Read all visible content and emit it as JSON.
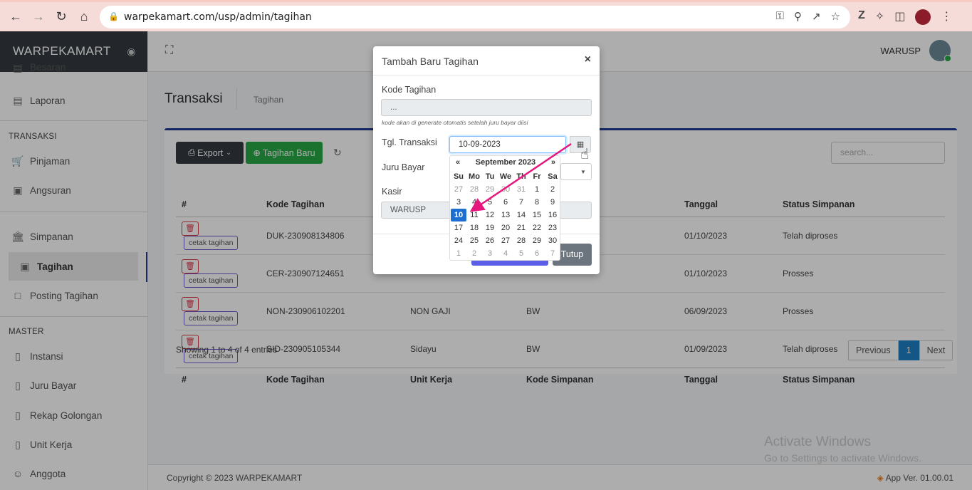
{
  "browser": {
    "url": "warpekamart.com/usp/admin/tagihan"
  },
  "sidebar": {
    "brand": "WARPEKAMART",
    "items_top": [
      {
        "label": "Besaran",
        "icon": "book-icon"
      },
      {
        "label": "Laporan",
        "icon": "clipboard-icon"
      }
    ],
    "section_transaksi": "TRANSAKSI",
    "transaksi_items": [
      {
        "label": "Pinjaman",
        "icon": "cart-icon"
      },
      {
        "label": "Angsuran",
        "icon": "money-icon"
      },
      {
        "label": "Simpanan",
        "icon": "bank-icon"
      },
      {
        "label": "Tagihan",
        "icon": "money-icon"
      },
      {
        "label": "Posting Tagihan",
        "icon": "file-icon"
      }
    ],
    "section_master": "MASTER",
    "master_items": [
      {
        "label": "Instansi",
        "icon": "book-icon"
      },
      {
        "label": "Juru Bayar",
        "icon": "book-icon"
      },
      {
        "label": "Rekap Golongan",
        "icon": "book-icon"
      },
      {
        "label": "Unit Kerja",
        "icon": "book-icon"
      },
      {
        "label": "Anggota",
        "icon": "user-icon"
      }
    ]
  },
  "topnav": {
    "username": "WARUSP"
  },
  "page": {
    "title": "Transaksi",
    "subtitle": "Tagihan"
  },
  "toolbar": {
    "export_label": "Export",
    "new_label": "Tagihan Baru",
    "search_placeholder": "search..."
  },
  "table": {
    "headers": [
      "#",
      "Kode Tagihan",
      "Unit Kerja",
      "Kode Simpanan",
      "Tanggal",
      "Status Simpanan"
    ],
    "cetak_label": "cetak tagihan",
    "rows": [
      {
        "kode": "DUK-230908134806",
        "unit": "",
        "simpanan": "",
        "tanggal": "01/10/2023",
        "status": "Telah diproses"
      },
      {
        "kode": "CER-230907124651",
        "unit": "",
        "simpanan": "",
        "tanggal": "01/10/2023",
        "status": "Prosses"
      },
      {
        "kode": "NON-230906102201",
        "unit": "NON GAJI",
        "simpanan": "BW",
        "tanggal": "06/09/2023",
        "status": "Prosses"
      },
      {
        "kode": "SID-230905105344",
        "unit": "Sidayu",
        "simpanan": "BW",
        "tanggal": "01/09/2023",
        "status": "Telah diproses"
      }
    ],
    "showing": "Showing 1 to 4 of 4 entries",
    "pager": {
      "previous": "Previous",
      "page": "1",
      "next": "Next"
    }
  },
  "footer": {
    "copyright": "Copyright © 2023 WARPEKAMART",
    "version": "App Ver. 01.00.01"
  },
  "watermark": {
    "line1": "Activate Windows",
    "line2": "Go to Settings to activate Windows."
  },
  "modal": {
    "title": "Tambah Baru Tagihan",
    "close": "×",
    "kode_label": "Kode Tagihan",
    "kode_placeholder": "...",
    "kode_help": "kode akan di generate otomatis setelah juru bayar diisi",
    "tgl_label": "Tgl. Transaksi",
    "tgl_value": "10-09-2023",
    "juru_label": "Juru Bayar",
    "kasir_label": "Kasir",
    "kasir_value": "WARUSP",
    "tutup_label": "Tutup"
  },
  "datepicker": {
    "prev": "«",
    "next": "»",
    "title": "September 2023",
    "dow": [
      "Su",
      "Mo",
      "Tu",
      "We",
      "Th",
      "Fr",
      "Sa"
    ],
    "days": [
      [
        "27",
        "old"
      ],
      [
        "28",
        "old"
      ],
      [
        "29",
        "old"
      ],
      [
        "30",
        "old"
      ],
      [
        "31",
        "old"
      ],
      [
        "1",
        ""
      ],
      [
        "2",
        ""
      ],
      [
        "3",
        ""
      ],
      [
        "4",
        ""
      ],
      [
        "5",
        ""
      ],
      [
        "6",
        ""
      ],
      [
        "7",
        ""
      ],
      [
        "8",
        ""
      ],
      [
        "9",
        ""
      ],
      [
        "10",
        "sel"
      ],
      [
        "11",
        ""
      ],
      [
        "12",
        ""
      ],
      [
        "13",
        ""
      ],
      [
        "14",
        ""
      ],
      [
        "15",
        ""
      ],
      [
        "16",
        ""
      ],
      [
        "17",
        ""
      ],
      [
        "18",
        ""
      ],
      [
        "19",
        ""
      ],
      [
        "20",
        ""
      ],
      [
        "21",
        ""
      ],
      [
        "22",
        ""
      ],
      [
        "23",
        ""
      ],
      [
        "24",
        ""
      ],
      [
        "25",
        ""
      ],
      [
        "26",
        ""
      ],
      [
        "27",
        ""
      ],
      [
        "28",
        ""
      ],
      [
        "29",
        ""
      ],
      [
        "30",
        ""
      ],
      [
        "1",
        "old"
      ],
      [
        "2",
        "old"
      ],
      [
        "3",
        "old"
      ],
      [
        "4",
        "old"
      ],
      [
        "5",
        "old"
      ],
      [
        "6",
        "old"
      ],
      [
        "7",
        "old"
      ]
    ]
  },
  "colors": {
    "annotation_arrow": "#e5177e",
    "brand_bar": "#343a40",
    "accent": "#1f3a93",
    "selected_day": "#1e6fcf"
  }
}
